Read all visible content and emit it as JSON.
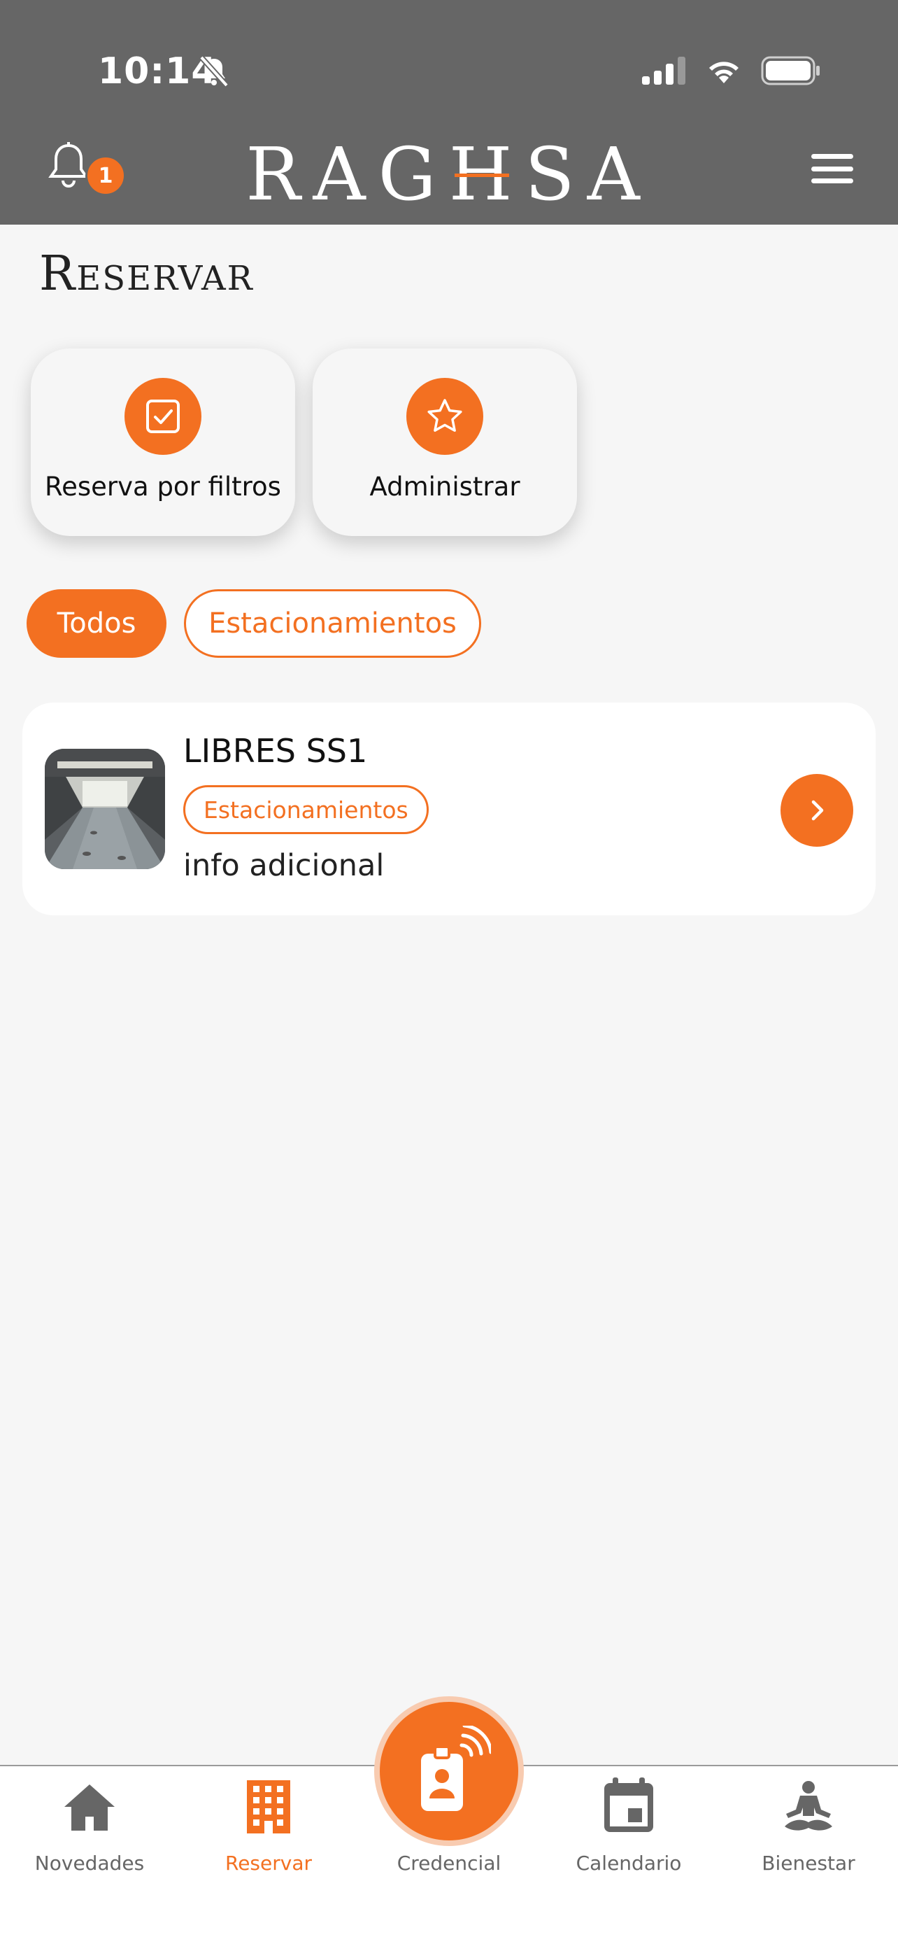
{
  "status_bar": {
    "time": "10:14"
  },
  "header": {
    "logo_pre": "RAG",
    "logo_h": "H",
    "logo_post": "SA",
    "notification_count": "1"
  },
  "page": {
    "title": "Reservar"
  },
  "actions": [
    {
      "label": "Reserva por filtros",
      "icon": "checkbox-icon"
    },
    {
      "label": "Administrar",
      "icon": "star-icon"
    }
  ],
  "filters": {
    "all_label": "Todos",
    "parking_label": "Estacionamientos"
  },
  "items": [
    {
      "title": "LIBRES SS1",
      "tag": "Estacionamientos",
      "info": "info adicional"
    }
  ],
  "tabbar": {
    "news": "Novedades",
    "reserve": "Reservar",
    "credential": "Credencial",
    "calendar": "Calendario",
    "wellness": "Bienestar"
  },
  "colors": {
    "accent": "#f37021",
    "header_bg": "#666666",
    "page_bg": "#f6f6f6"
  }
}
